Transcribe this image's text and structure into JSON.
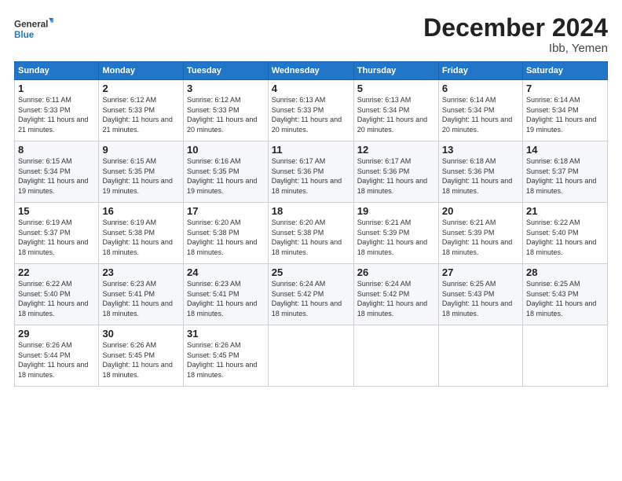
{
  "logo": {
    "general": "General",
    "blue": "Blue"
  },
  "title": "December 2024",
  "location": "Ibb, Yemen",
  "days_header": [
    "Sunday",
    "Monday",
    "Tuesday",
    "Wednesday",
    "Thursday",
    "Friday",
    "Saturday"
  ],
  "weeks": [
    [
      {
        "day": "1",
        "sunrise": "6:11 AM",
        "sunset": "5:33 PM",
        "daylight": "11 hours and 21 minutes."
      },
      {
        "day": "2",
        "sunrise": "6:12 AM",
        "sunset": "5:33 PM",
        "daylight": "11 hours and 21 minutes."
      },
      {
        "day": "3",
        "sunrise": "6:12 AM",
        "sunset": "5:33 PM",
        "daylight": "11 hours and 20 minutes."
      },
      {
        "day": "4",
        "sunrise": "6:13 AM",
        "sunset": "5:33 PM",
        "daylight": "11 hours and 20 minutes."
      },
      {
        "day": "5",
        "sunrise": "6:13 AM",
        "sunset": "5:34 PM",
        "daylight": "11 hours and 20 minutes."
      },
      {
        "day": "6",
        "sunrise": "6:14 AM",
        "sunset": "5:34 PM",
        "daylight": "11 hours and 20 minutes."
      },
      {
        "day": "7",
        "sunrise": "6:14 AM",
        "sunset": "5:34 PM",
        "daylight": "11 hours and 19 minutes."
      }
    ],
    [
      {
        "day": "8",
        "sunrise": "6:15 AM",
        "sunset": "5:34 PM",
        "daylight": "11 hours and 19 minutes."
      },
      {
        "day": "9",
        "sunrise": "6:15 AM",
        "sunset": "5:35 PM",
        "daylight": "11 hours and 19 minutes."
      },
      {
        "day": "10",
        "sunrise": "6:16 AM",
        "sunset": "5:35 PM",
        "daylight": "11 hours and 19 minutes."
      },
      {
        "day": "11",
        "sunrise": "6:17 AM",
        "sunset": "5:36 PM",
        "daylight": "11 hours and 18 minutes."
      },
      {
        "day": "12",
        "sunrise": "6:17 AM",
        "sunset": "5:36 PM",
        "daylight": "11 hours and 18 minutes."
      },
      {
        "day": "13",
        "sunrise": "6:18 AM",
        "sunset": "5:36 PM",
        "daylight": "11 hours and 18 minutes."
      },
      {
        "day": "14",
        "sunrise": "6:18 AM",
        "sunset": "5:37 PM",
        "daylight": "11 hours and 18 minutes."
      }
    ],
    [
      {
        "day": "15",
        "sunrise": "6:19 AM",
        "sunset": "5:37 PM",
        "daylight": "11 hours and 18 minutes."
      },
      {
        "day": "16",
        "sunrise": "6:19 AM",
        "sunset": "5:38 PM",
        "daylight": "11 hours and 18 minutes."
      },
      {
        "day": "17",
        "sunrise": "6:20 AM",
        "sunset": "5:38 PM",
        "daylight": "11 hours and 18 minutes."
      },
      {
        "day": "18",
        "sunrise": "6:20 AM",
        "sunset": "5:38 PM",
        "daylight": "11 hours and 18 minutes."
      },
      {
        "day": "19",
        "sunrise": "6:21 AM",
        "sunset": "5:39 PM",
        "daylight": "11 hours and 18 minutes."
      },
      {
        "day": "20",
        "sunrise": "6:21 AM",
        "sunset": "5:39 PM",
        "daylight": "11 hours and 18 minutes."
      },
      {
        "day": "21",
        "sunrise": "6:22 AM",
        "sunset": "5:40 PM",
        "daylight": "11 hours and 18 minutes."
      }
    ],
    [
      {
        "day": "22",
        "sunrise": "6:22 AM",
        "sunset": "5:40 PM",
        "daylight": "11 hours and 18 minutes."
      },
      {
        "day": "23",
        "sunrise": "6:23 AM",
        "sunset": "5:41 PM",
        "daylight": "11 hours and 18 minutes."
      },
      {
        "day": "24",
        "sunrise": "6:23 AM",
        "sunset": "5:41 PM",
        "daylight": "11 hours and 18 minutes."
      },
      {
        "day": "25",
        "sunrise": "6:24 AM",
        "sunset": "5:42 PM",
        "daylight": "11 hours and 18 minutes."
      },
      {
        "day": "26",
        "sunrise": "6:24 AM",
        "sunset": "5:42 PM",
        "daylight": "11 hours and 18 minutes."
      },
      {
        "day": "27",
        "sunrise": "6:25 AM",
        "sunset": "5:43 PM",
        "daylight": "11 hours and 18 minutes."
      },
      {
        "day": "28",
        "sunrise": "6:25 AM",
        "sunset": "5:43 PM",
        "daylight": "11 hours and 18 minutes."
      }
    ],
    [
      {
        "day": "29",
        "sunrise": "6:26 AM",
        "sunset": "5:44 PM",
        "daylight": "11 hours and 18 minutes."
      },
      {
        "day": "30",
        "sunrise": "6:26 AM",
        "sunset": "5:45 PM",
        "daylight": "11 hours and 18 minutes."
      },
      {
        "day": "31",
        "sunrise": "6:26 AM",
        "sunset": "5:45 PM",
        "daylight": "11 hours and 18 minutes."
      },
      null,
      null,
      null,
      null
    ]
  ],
  "labels": {
    "sunrise_prefix": "Sunrise: ",
    "sunset_prefix": "Sunset: ",
    "daylight_prefix": "Daylight: "
  }
}
